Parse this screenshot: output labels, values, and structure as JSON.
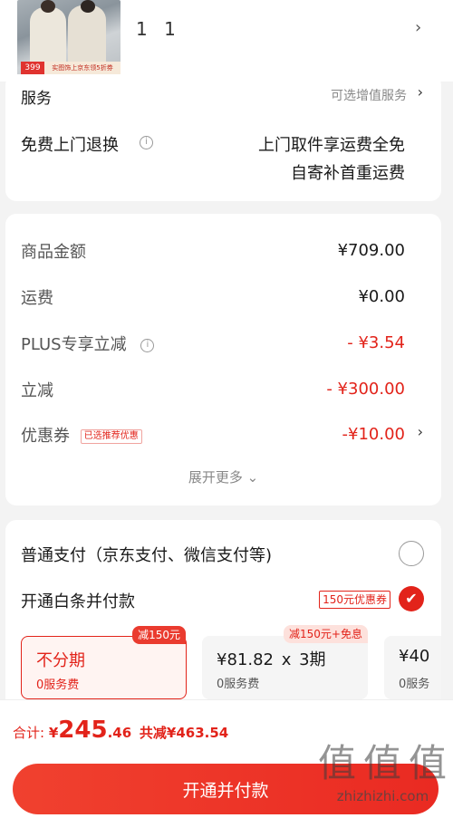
{
  "product": {
    "thumb_price": "399",
    "thumb_promo": "实图饰上京东领5折券",
    "quantity": "1 1"
  },
  "service": {
    "cut_label": "服务",
    "cut_value": "可选增值服务",
    "label": "免费上门退换",
    "desc_line1": "上门取件享运费全免",
    "desc_line2": "自寄补首重运费"
  },
  "price": {
    "rows": [
      {
        "label": "商品金额",
        "value": "¥709.00"
      },
      {
        "label": "运费",
        "value": "¥0.00"
      },
      {
        "label": "PLUS专享立减",
        "value": "- ¥3.54"
      },
      {
        "label": "立减",
        "value": "- ¥300.00"
      },
      {
        "label": "优惠券",
        "value": "-¥10.00",
        "tag": "已选推荐优惠"
      }
    ],
    "expand": "展开更多"
  },
  "payment": {
    "normal_label": "普通支付（京东支付、微信支付等)",
    "baitiao_label": "开通白条并付款",
    "baitiao_coupon": "150元优惠券",
    "plans": [
      {
        "main": "不分期",
        "sub": "0服务费",
        "badge": "减150元"
      },
      {
        "main_amount": "¥81.82",
        "main_x": "x",
        "main_periods": "3期",
        "sub": "0服务费",
        "badge": "减150元+免息"
      },
      {
        "main": "¥40",
        "sub": "0服务"
      }
    ]
  },
  "bottom": {
    "total_label": "合计:",
    "currency": "¥",
    "total_int": "245",
    "total_dec": ".46",
    "saved": "共减¥463.54",
    "submit": "开通并付款"
  },
  "watermark": {
    "chars": [
      "值",
      "值",
      "值"
    ],
    "url": "zhizhizhi.com"
  },
  "colors": {
    "accent": "#e2231a",
    "background": "#f3f3f3"
  }
}
